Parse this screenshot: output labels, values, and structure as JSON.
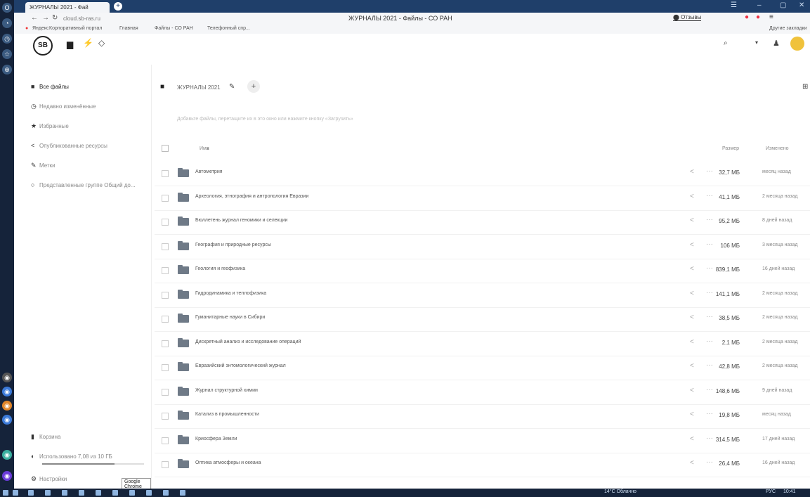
{
  "browser": {
    "tab_title": "ЖУРНАЛЫ 2021 - Фай",
    "address": "cloud.sb-ras.ru",
    "window_title": "ЖУРНАЛЫ 2021 - Файлы - СО РАН",
    "bookmarks": [
      "Яндекс",
      "Корпоративный портал",
      "Главная",
      "Файлы - СО РАН",
      "Телефонный спр..."
    ],
    "other_bookmarks": "Другие закладки"
  },
  "sidebar": {
    "items": [
      {
        "icon": "folder-icon",
        "label": "Все файлы"
      },
      {
        "icon": "clock-icon",
        "label": "Недавно изменённые"
      },
      {
        "icon": "star-icon",
        "label": "Избранные"
      },
      {
        "icon": "share-icon",
        "label": "Опубликованные ресурсы"
      },
      {
        "icon": "tag-icon",
        "label": "Метки"
      },
      {
        "icon": "external-storage-icon",
        "label": "Представленные группе Общий до..."
      }
    ],
    "bottom": [
      {
        "icon": "trash-icon",
        "label": "Корзина"
      },
      {
        "icon": "quota-icon",
        "label": "Использовано 7,08 из 10 ГБ"
      },
      {
        "icon": "gear-icon",
        "label": "Настройки"
      }
    ],
    "tooltip": "Google Chrome"
  },
  "breadcrumb": "ЖУРНАЛЫ 2021",
  "dropzone_hint": "Добавьте файлы, перетащите их в это окно или нажмите кнопку «Загрузить»",
  "table": {
    "col_name": "Имя",
    "col_size": "Размер",
    "col_modified": "Изменено",
    "rows": [
      {
        "name": "Автометрия",
        "size": "32,7 МБ",
        "date": "месяц назад"
      },
      {
        "name": "Археология, этнография и антропология Евразии",
        "size": "41,1 МБ",
        "date": "2 месяца назад"
      },
      {
        "name": "Бюллетень журнал геномики и селекции",
        "size": "95,2 МБ",
        "date": "8 дней назад"
      },
      {
        "name": "География и природные ресурсы",
        "size": "106 МБ",
        "date": "3 месяца назад"
      },
      {
        "name": "Геология и геофизика",
        "size": "839,1 МБ",
        "date": "16 дней назад"
      },
      {
        "name": "Гидродинамика и теплофизика",
        "size": "141,1 МБ",
        "date": "2 месяца назад"
      },
      {
        "name": "Гуманитарные науки в Сибири",
        "size": "38,5 МБ",
        "date": "2 месяца назад"
      },
      {
        "name": "Дискретный анализ и исследование операций",
        "size": "2,1 МБ",
        "date": "2 месяца назад"
      },
      {
        "name": "Евразийский энтомологический журнал",
        "size": "42,8 МБ",
        "date": "2 месяца назад"
      },
      {
        "name": "Журнал структурной химии",
        "size": "148,6 МБ",
        "date": "9 дней назад"
      },
      {
        "name": "Катализ в промышленности",
        "size": "19,8 МБ",
        "date": "месяц назад"
      },
      {
        "name": "Криосфера Земли",
        "size": "314,5 МБ",
        "date": "17 дней назад"
      },
      {
        "name": "Оптика атмосферы и океана",
        "size": "26,4 МБ",
        "date": "16 дней назад"
      }
    ]
  },
  "taskbar": {
    "weather": "14°C Облачно",
    "lang": "РУС",
    "time": "10:41"
  }
}
